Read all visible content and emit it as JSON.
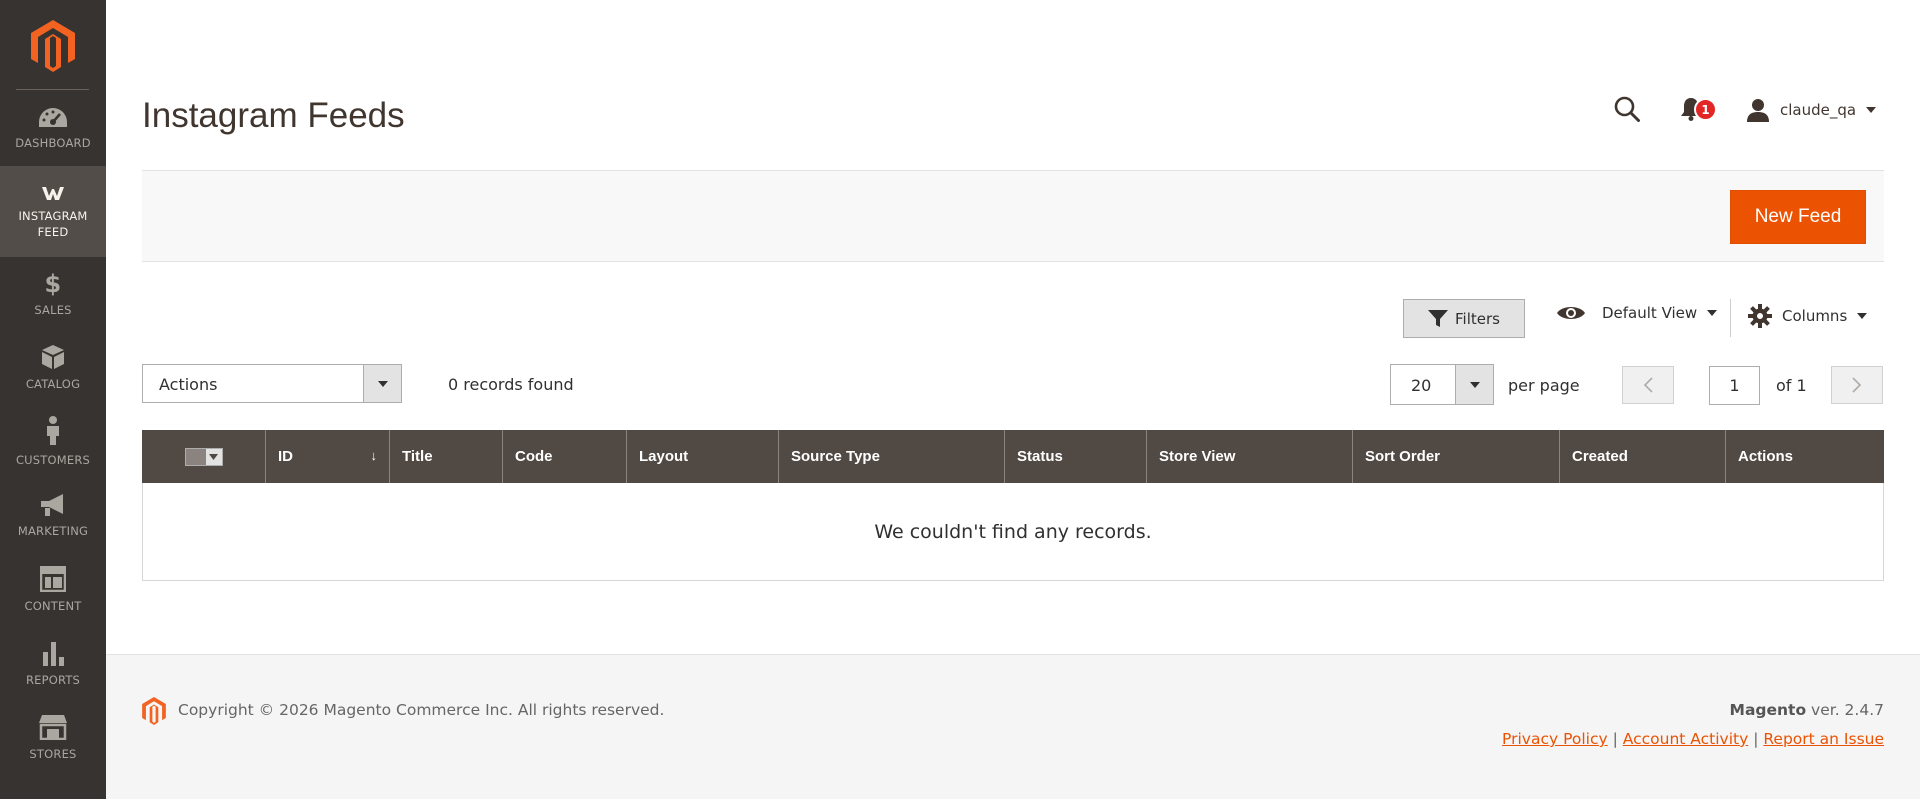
{
  "sidebar": {
    "logo": "magento-logo",
    "items": [
      {
        "label": "DASHBOARD",
        "icon": "dashboard-icon"
      },
      {
        "label": "INSTAGRAM FEED",
        "icon": "instagram-feed-icon",
        "active": true
      },
      {
        "label": "SALES",
        "icon": "dollar-icon"
      },
      {
        "label": "CATALOG",
        "icon": "cube-icon"
      },
      {
        "label": "CUSTOMERS",
        "icon": "person-icon"
      },
      {
        "label": "MARKETING",
        "icon": "megaphone-icon"
      },
      {
        "label": "CONTENT",
        "icon": "layout-icon"
      },
      {
        "label": "REPORTS",
        "icon": "bar-chart-icon"
      },
      {
        "label": "STORES",
        "icon": "store-icon"
      }
    ]
  },
  "header": {
    "title": "Instagram Feeds",
    "notification_count": "1",
    "username": "claude_qa"
  },
  "actionbar": {
    "new_feed_label": "New Feed"
  },
  "toolbar": {
    "filters_label": "Filters",
    "view_label": "Default View",
    "columns_label": "Columns",
    "actions_label": "Actions",
    "records_found": "0 records found",
    "per_page_value": "20",
    "per_page_label": "per page",
    "page_value": "1",
    "page_of": "of 1"
  },
  "grid": {
    "columns": [
      "ID",
      "Title",
      "Code",
      "Layout",
      "Source Type",
      "Status",
      "Store View",
      "Sort Order",
      "Created",
      "Actions"
    ],
    "sort_indicator": "↓",
    "empty_message": "We couldn't find any records."
  },
  "footer": {
    "copyright": "Copyright © 2026 Magento Commerce Inc. All rights reserved.",
    "brand": "Magento",
    "version": "ver. 2.4.7",
    "links": [
      "Privacy Policy",
      "Account Activity",
      "Report an Issue"
    ]
  },
  "colors": {
    "sidebar_bg": "#373330",
    "accent": "#eb5202",
    "grid_header_bg": "#514943"
  }
}
